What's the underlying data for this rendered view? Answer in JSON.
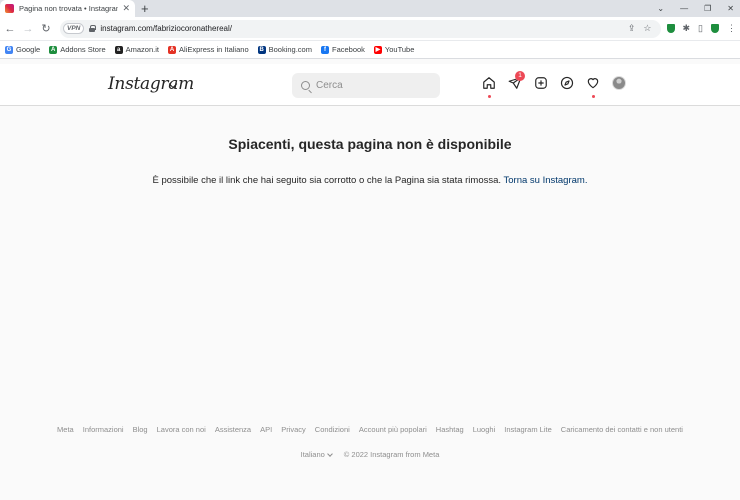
{
  "browser": {
    "tab_title": "Pagina non trovata • Instagram",
    "new_tab_label": "+",
    "url": "instagram.com/fabriziocoronathereal/",
    "vpn_label": "VPN",
    "bookmarks": [
      {
        "label": "Google",
        "color": "#4285f4",
        "glyph": "G"
      },
      {
        "label": "Addons Store",
        "color": "#1e8e3e",
        "glyph": "A"
      },
      {
        "label": "Amazon.it",
        "color": "#222222",
        "glyph": "a"
      },
      {
        "label": "AliExpress in Italiano",
        "color": "#e43225",
        "glyph": "A"
      },
      {
        "label": "Booking.com",
        "color": "#003580",
        "glyph": "B"
      },
      {
        "label": "Facebook",
        "color": "#1877f2",
        "glyph": "f"
      },
      {
        "label": "YouTube",
        "color": "#ff0000",
        "glyph": "▶"
      }
    ]
  },
  "instagram": {
    "logo": "Instagram",
    "search_placeholder": "Cerca",
    "notification_count": "1",
    "accent_color": "#ed4956"
  },
  "error": {
    "title": "Spiacenti, questa pagina non è disponibile",
    "message": "È possibile che il link che hai seguito sia corrotto o che la Pagina sia stata rimossa.",
    "link": "Torna su Instagram."
  },
  "footer": {
    "links": [
      "Meta",
      "Informazioni",
      "Blog",
      "Lavora con noi",
      "Assistenza",
      "API",
      "Privacy",
      "Condizioni",
      "Account più popolari",
      "Hashtag",
      "Luoghi",
      "Instagram Lite",
      "Caricamento dei contatti e non utenti"
    ],
    "language": "Italiano",
    "copyright": "© 2022 Instagram from Meta"
  }
}
